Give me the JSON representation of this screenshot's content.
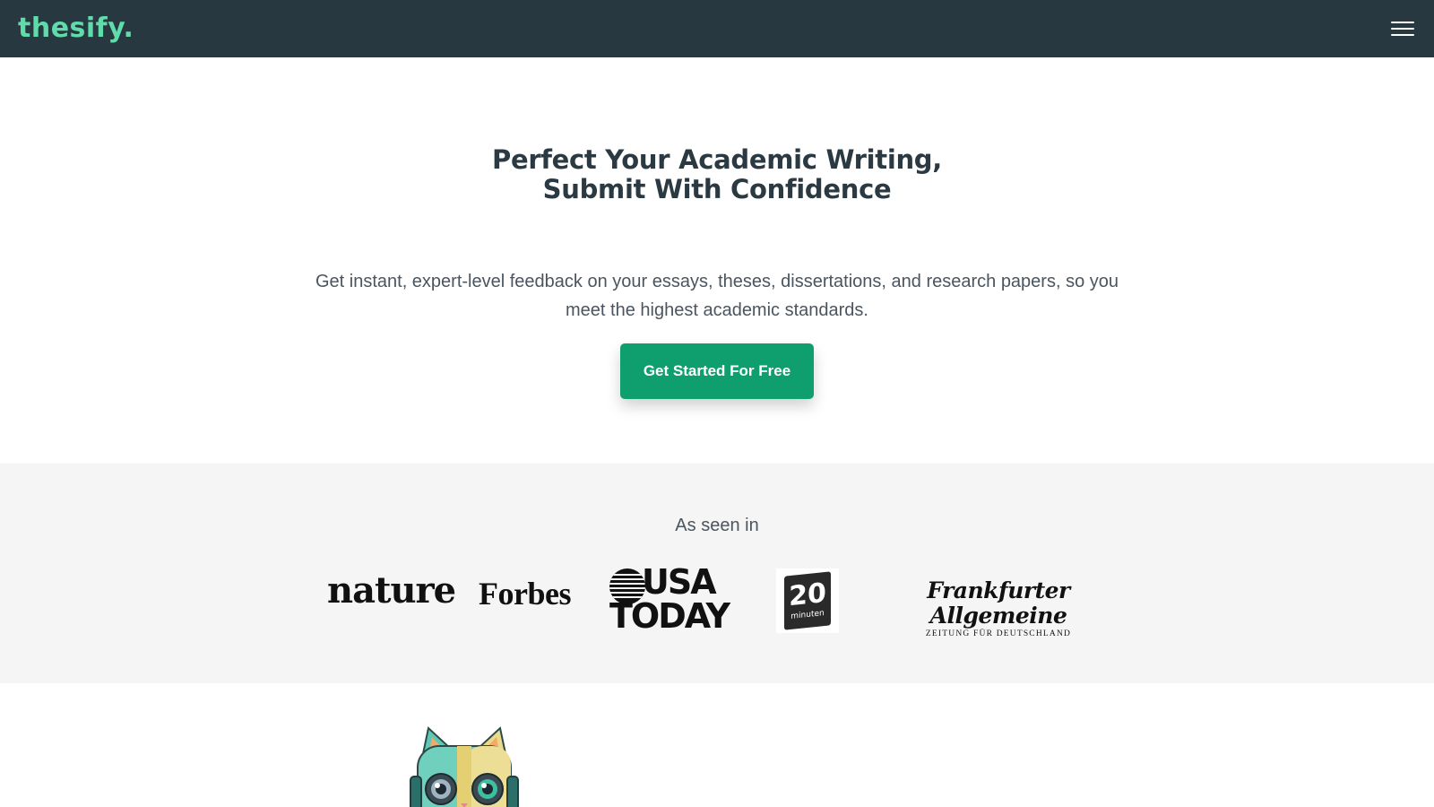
{
  "header": {
    "logo_text": "thesify.",
    "menu_icon": "hamburger-menu-icon",
    "background": "#283841",
    "logo_color": "#5fdcaa"
  },
  "hero": {
    "title_line1": "Perfect Your Academic Writing,",
    "title_line2": "Submit With Confidence",
    "subtitle": "Get instant, expert-level feedback on your essays, theses, dissertations, and research papers, so you meet the highest academic standards.",
    "cta_label": "Get Started For Free",
    "cta_color": "#0f9f6e"
  },
  "press": {
    "heading": "As seen in",
    "logos": {
      "nature": "nature",
      "forbes": "Forbes",
      "usatoday_line1": "USA",
      "usatoday_line2": "TODAY",
      "twenty_min_number": "20",
      "twenty_min_word": "minuten",
      "faz_name": "Frankfurter Allgemeine",
      "faz_sub": "ZEITUNG FÜR DEUTSCHLAND"
    }
  },
  "mascot": {
    "icon": "robot-cat-mascot-icon"
  }
}
